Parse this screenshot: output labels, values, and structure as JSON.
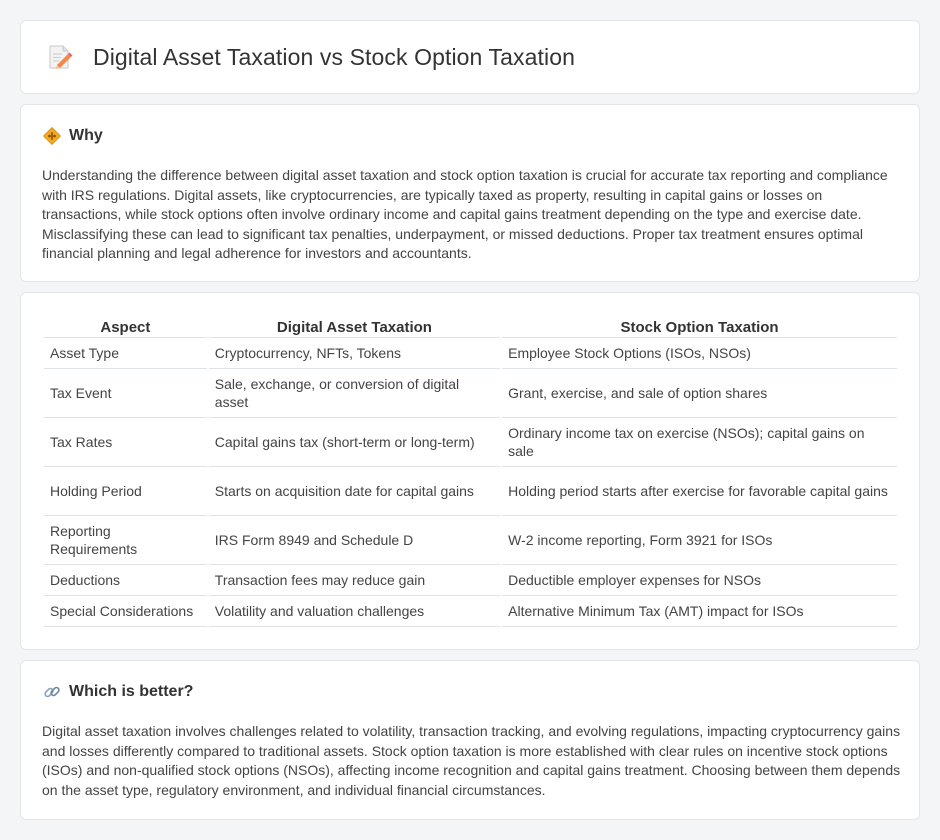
{
  "header": {
    "title": "Digital Asset Taxation vs Stock Option Taxation",
    "icon": "memo-pencil-icon"
  },
  "why": {
    "icon": "diamond-sign-icon",
    "heading": "Why",
    "text": "Understanding the difference between digital asset taxation and stock option taxation is crucial for accurate tax reporting and compliance with IRS regulations. Digital assets, like cryptocurrencies, are typically taxed as property, resulting in capital gains or losses on transactions, while stock options often involve ordinary income and capital gains treatment depending on the type and exercise date. Misclassifying these can lead to significant tax penalties, underpayment, or missed deductions. Proper tax treatment ensures optimal financial planning and legal adherence for investors and accountants."
  },
  "table": {
    "headers": [
      "Aspect",
      "Digital Asset Taxation",
      "Stock Option Taxation"
    ],
    "rows": [
      [
        "Asset Type",
        "Cryptocurrency, NFTs, Tokens",
        "Employee Stock Options (ISOs, NSOs)"
      ],
      [
        "Tax Event",
        "Sale, exchange, or conversion of digital asset",
        "Grant, exercise, and sale of option shares"
      ],
      [
        "Tax Rates",
        "Capital gains tax (short-term or long-term)",
        "Ordinary income tax on exercise (NSOs); capital gains on sale"
      ],
      [
        "Holding Period",
        "Starts on acquisition date for capital gains",
        "Holding period starts after exercise for favorable capital gains"
      ],
      [
        "Reporting Requirements",
        "IRS Form 8949 and Schedule D",
        "W-2 income reporting, Form 3921 for ISOs"
      ],
      [
        "Deductions",
        "Transaction fees may reduce gain",
        "Deductible employer expenses for NSOs"
      ],
      [
        "Special Considerations",
        "Volatility and valuation challenges",
        "Alternative Minimum Tax (AMT) impact for ISOs"
      ]
    ]
  },
  "better": {
    "icon": "link-icon",
    "heading": "Which is better?",
    "text": "Digital asset taxation involves challenges related to volatility, transaction tracking, and evolving regulations, impacting cryptocurrency gains and losses differently compared to traditional assets. Stock option taxation is more established with clear rules on incentive stock options (ISOs) and non-qualified stock options (NSOs), affecting income recognition and capital gains treatment. Choosing between them depends on the asset type, regulatory environment, and individual financial circumstances."
  }
}
